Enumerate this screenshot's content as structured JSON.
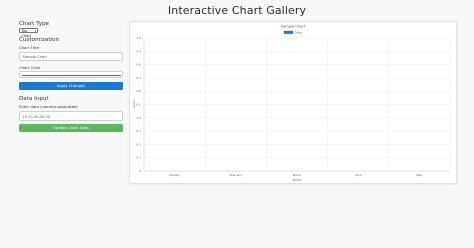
{
  "page": {
    "title": "Interactive Chart Gallery"
  },
  "sidebar": {
    "chart_type": {
      "heading": "Chart Type",
      "selected": "Bar Chart"
    },
    "customization": {
      "heading": "Customization",
      "title_label": "Chart Title",
      "title_value": "Sample Chart",
      "color_label": "Chart Color",
      "color_value": "#666666",
      "apply_button": "Apply Changes"
    },
    "data_input": {
      "heading": "Data Input",
      "data_label": "Enter data (comma-separated)",
      "data_value": "10,20,30,40,50",
      "update_button": "Update Chart Data"
    }
  },
  "chart_data": {
    "type": "bar",
    "title": "Sample Chart",
    "legend": [
      "Data"
    ],
    "legend_color": "#1d79d1",
    "xlabel": "Month",
    "ylabel": "Value",
    "categories": [
      "January",
      "February",
      "March",
      "April",
      "May"
    ],
    "series": [
      {
        "name": "Data",
        "values": []
      }
    ],
    "y_ticks": [
      "1.0",
      "0.9",
      "0.8",
      "0.7",
      "0.6",
      "0.5",
      "0.4",
      "0.3",
      "0.2",
      "0.1",
      "0"
    ],
    "ylim": [
      0,
      1
    ],
    "grid": true,
    "legend_position": "top-center"
  }
}
